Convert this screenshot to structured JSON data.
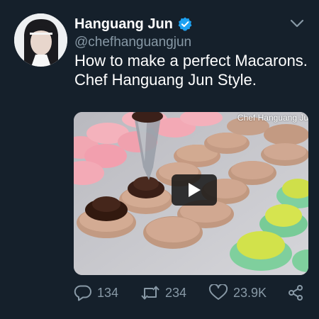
{
  "author": {
    "display_name": "Hanguang Jun",
    "handle": "@chefhanguangjun",
    "verified_icon": "verified-badge-icon",
    "verified_color": "#1da1f2"
  },
  "tweet": {
    "text": "How to make a perfect Macarons. Chef Hanguang Jun Style."
  },
  "media": {
    "watermark": "Chef Hanguang Ju",
    "play_icon": "play-icon"
  },
  "actions": {
    "replies": "134",
    "retweets": "234",
    "likes": "23.9K"
  },
  "colors": {
    "background": "#15202b",
    "secondary_text": "#8899a6"
  }
}
